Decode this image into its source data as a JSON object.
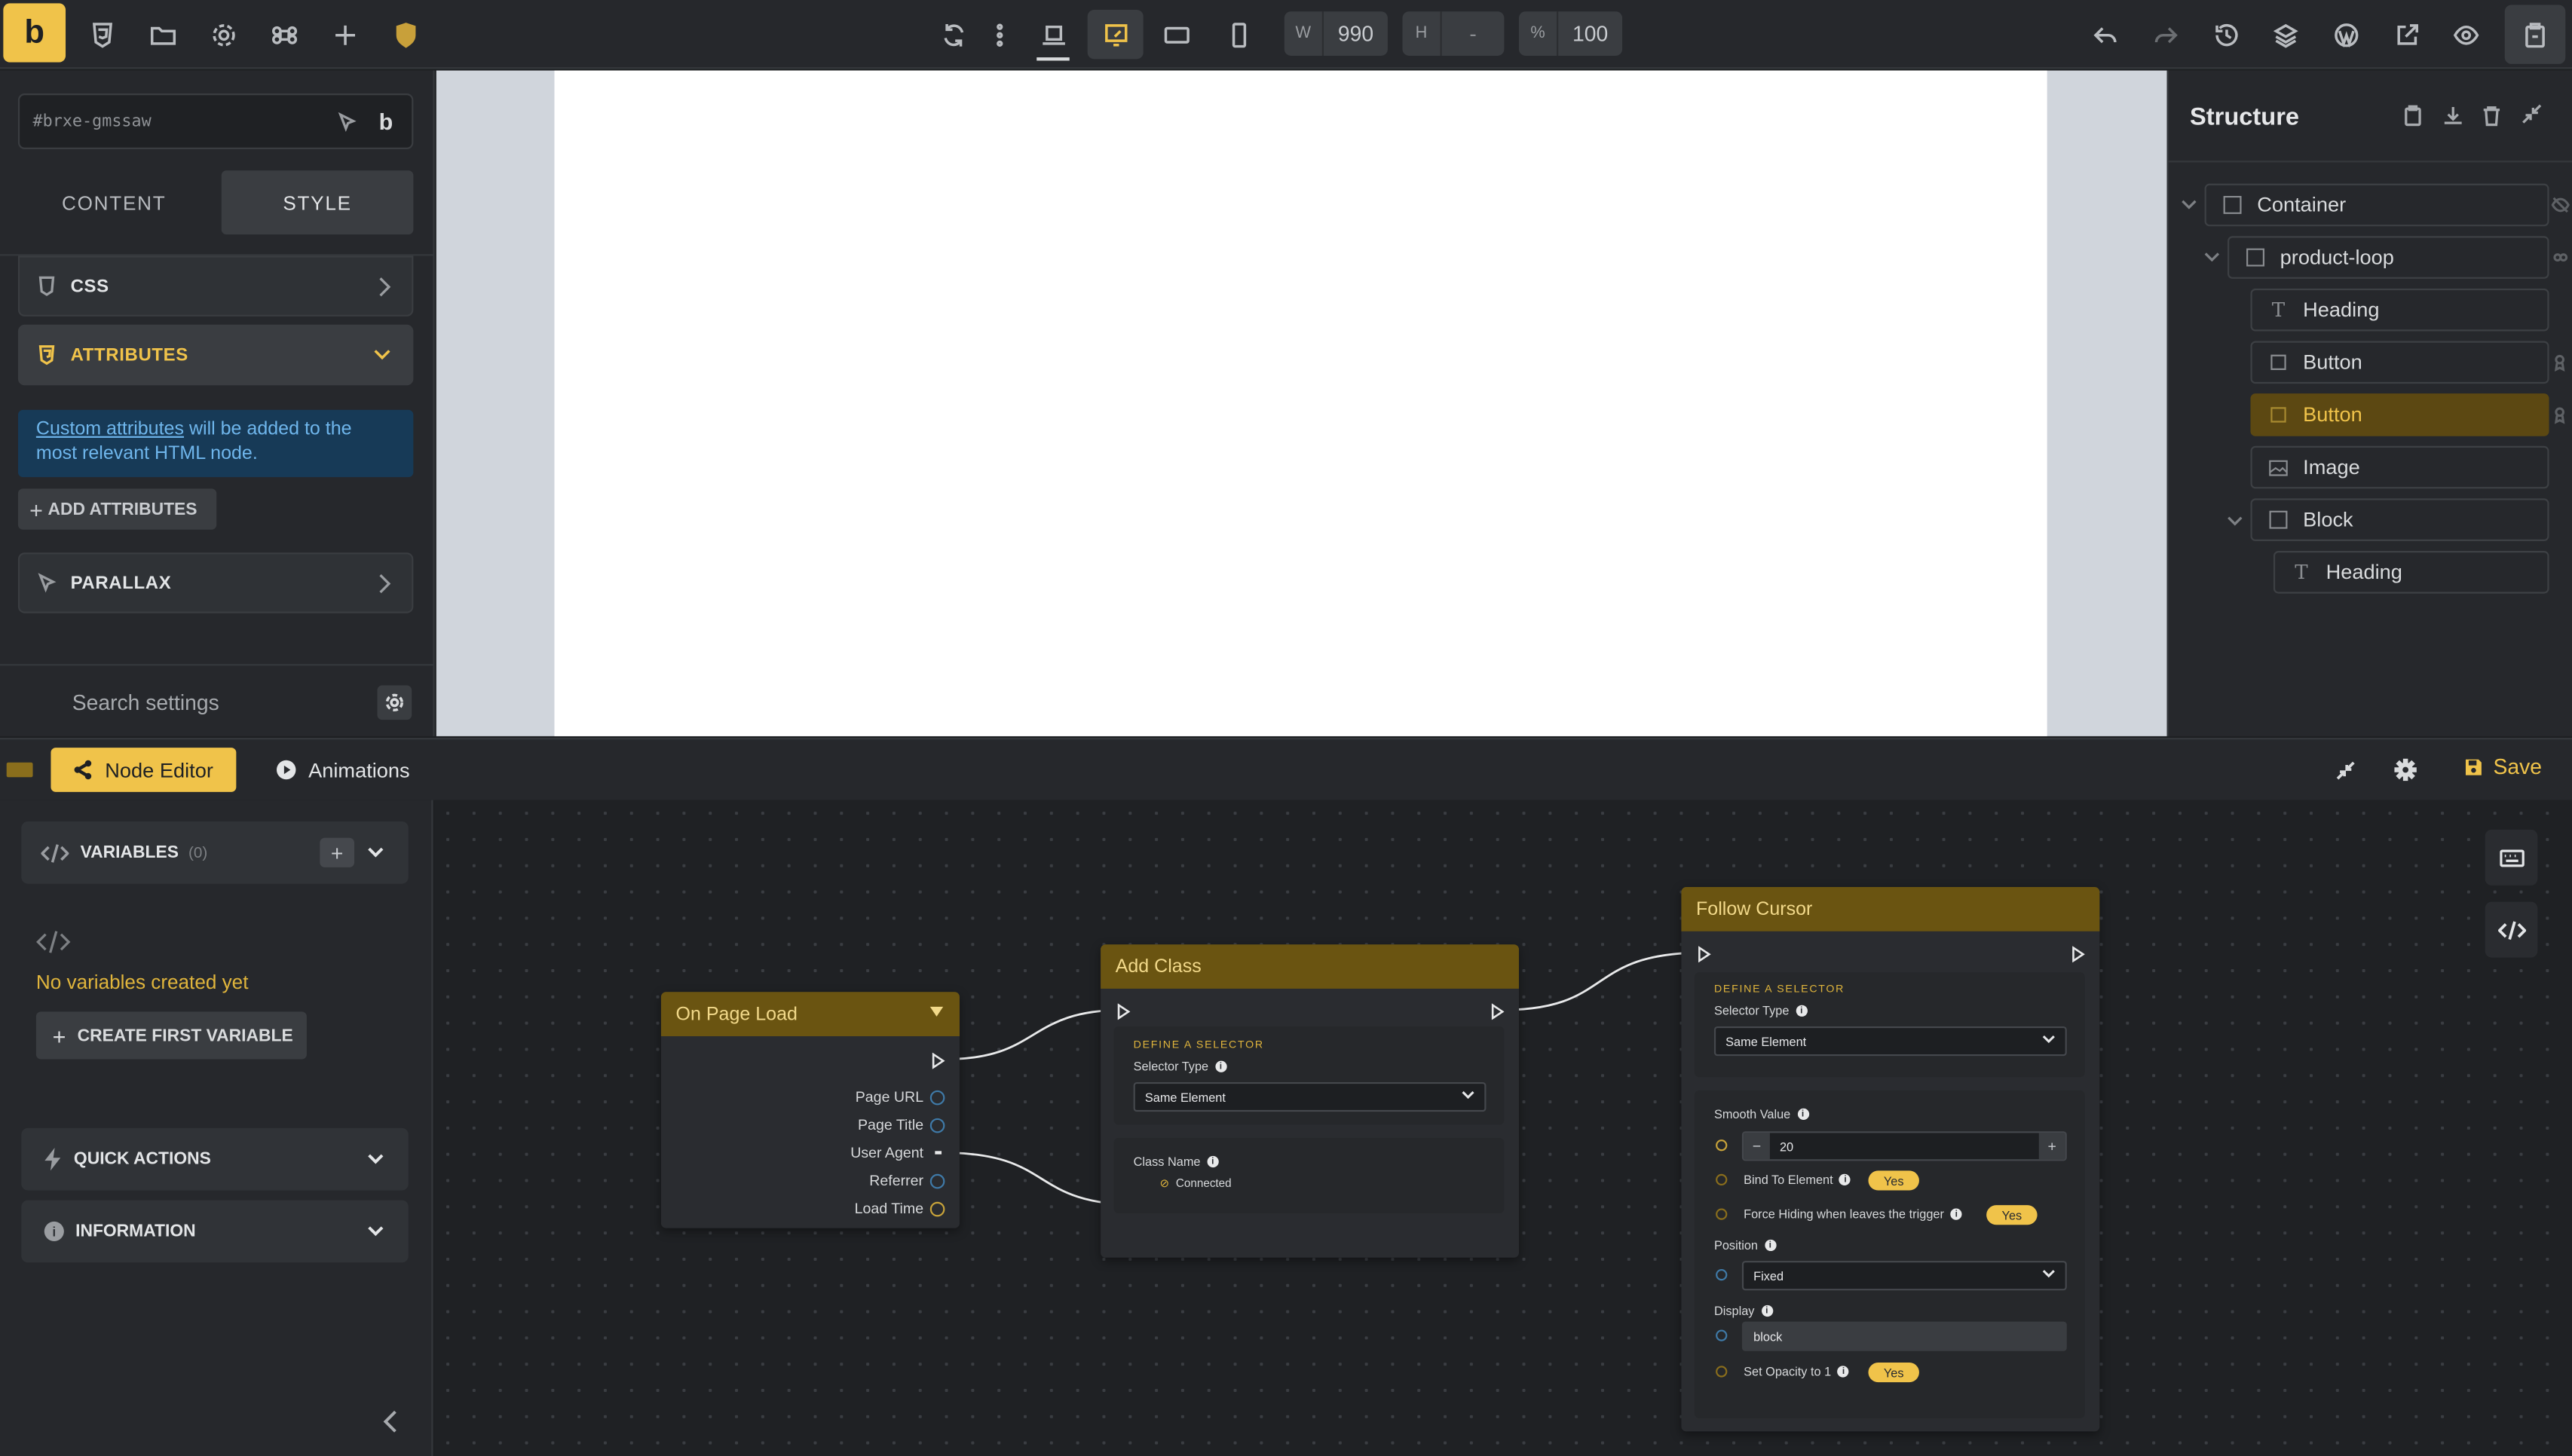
{
  "topbar": {
    "logo": "b",
    "width": {
      "label": "W",
      "value": "990"
    },
    "height": {
      "label": "H",
      "value": "-"
    },
    "zoom": {
      "label": "%",
      "value": "100"
    }
  },
  "left_panel": {
    "selector_placeholder": "#brxe-gmssaw",
    "selector_badge": "b",
    "tab_content": "CONTENT",
    "tab_style": "STYLE",
    "css_label": "CSS",
    "attributes_label": "ATTRIBUTES",
    "info_link": "Custom attributes",
    "info_text": " will be added to the most relevant HTML node.",
    "add_attributes": "ADD ATTRIBUTES",
    "parallax_label": "PARALLAX",
    "search_placeholder": "Search settings"
  },
  "structure": {
    "title": "Structure",
    "items": [
      {
        "label": "Container"
      },
      {
        "label": "product-loop"
      },
      {
        "label": "Heading"
      },
      {
        "label": "Button"
      },
      {
        "label": "Button"
      },
      {
        "label": "Image"
      },
      {
        "label": "Block"
      },
      {
        "label": "Heading"
      }
    ]
  },
  "bottom_bar": {
    "node_editor": "Node Editor",
    "animations": "Animations",
    "save": "Save"
  },
  "bottom_left": {
    "variables_label": "VARIABLES",
    "variables_count": "(0)",
    "empty_text": "No variables created yet",
    "create_button": "CREATE FIRST VARIABLE",
    "quick_actions": "QUICK ACTIONS",
    "information": "INFORMATION"
  },
  "nodes": {
    "page_load": {
      "title": "On Page Load",
      "outputs": [
        "Page URL",
        "Page Title",
        "User Agent",
        "Referrer",
        "Load Time"
      ]
    },
    "add_class": {
      "title": "Add Class",
      "section_label": "DEFINE A SELECTOR",
      "selector_type_label": "Selector Type",
      "selector_type_value": "Same Element",
      "class_name_label": "Class Name",
      "connected": "Connected"
    },
    "follow_cursor": {
      "title": "Follow Cursor",
      "section_label": "DEFINE A SELECTOR",
      "selector_type_label": "Selector Type",
      "selector_type_value": "Same Element",
      "smooth_label": "Smooth Value",
      "smooth_value": "20",
      "bind_label": "Bind To Element",
      "bind_value": "Yes",
      "force_label": "Force Hiding when leaves the trigger",
      "force_value": "Yes",
      "position_label": "Position",
      "position_value": "Fixed",
      "display_label": "Display",
      "display_value": "block",
      "opacity_label": "Set Opacity to 1",
      "opacity_value": "Yes"
    }
  },
  "colors": {
    "accent": "#f0c34a",
    "brand": "#f0c34a",
    "info_bg": "#173a57"
  }
}
